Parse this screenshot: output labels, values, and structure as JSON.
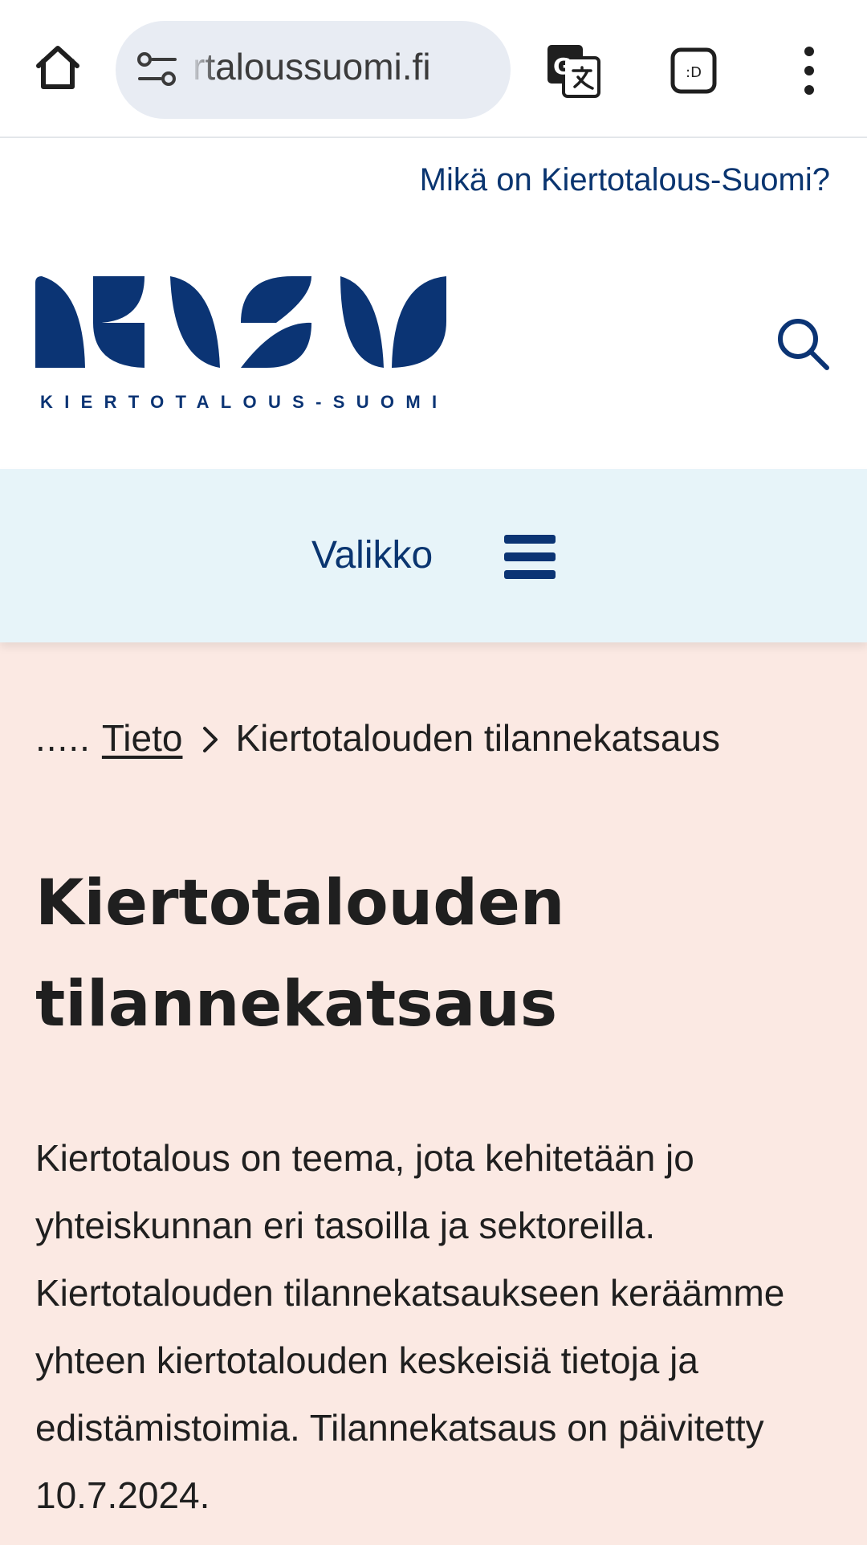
{
  "browser": {
    "url_display": "rtaloussuomi.fi"
  },
  "header": {
    "what_is_link": "Mikä on Kiertotalous-Suomi?",
    "logo_text": "KIERTOTALOUS-SUOMI"
  },
  "nav": {
    "menu_label": "Valikko"
  },
  "breadcrumb": {
    "ellipsis": ".....",
    "parent": "Tieto",
    "current": "Kiertotalouden tilannekatsaus"
  },
  "page": {
    "title_line1": "Kiertotalouden",
    "title_line2": "tilannekatsaus",
    "intro": "Kiertotalous on teema, jota kehitetään jo yhteiskunnan eri tasoilla ja sektoreilla. Kiertotalouden tilannekatsaukseen keräämme yhteen kiertotalouden keskeisiä tietoja ja edistämistoimia. Tilannekatsaus on päivitetty 10.7.2024."
  },
  "colors": {
    "brand_navy": "#0b3474",
    "nav_background": "#e7f4f9",
    "content_background": "#fbe9e3"
  },
  "icons": {
    "home": "home-icon",
    "site_settings": "site-settings-icon",
    "translate": "translate-icon",
    "tabs": "tab-switcher-icon",
    "menu": "more-vert-icon",
    "search": "search-icon",
    "hamburger": "hamburger-icon",
    "chevron": "chevron-right-icon"
  }
}
